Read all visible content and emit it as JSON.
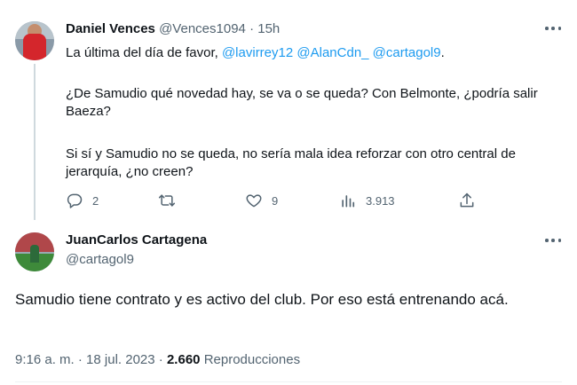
{
  "reply_tweet": {
    "author": {
      "name": "Daniel Vences",
      "handle": "@Vences1094",
      "separator": "·",
      "time": "15h"
    },
    "text": {
      "p1_prefix": "La última del día de favor, ",
      "mentions": [
        "@lavirrey12",
        "@AlanCdn_",
        "@cartagol9"
      ],
      "p1_suffix": ".",
      "p2": "¿De Samudio qué novedad hay, se va o se queda? Con Belmonte, ¿podría salir Baeza?",
      "p3": "Si sí y Samudio no se queda, no sería mala idea reforzar con otro central de jerarquía, ¿no creen?"
    },
    "actions": {
      "replies": "2",
      "retweets": "",
      "likes": "9",
      "views": "3.913"
    }
  },
  "main_tweet": {
    "author": {
      "name": "JuanCarlos Cartagena",
      "handle": "@cartagol9"
    },
    "text": "Samudio tiene contrato y es activo del club. Por eso está entrenando acá.",
    "meta": {
      "time": "9:16 a. m.",
      "separator": "·",
      "date": "18 jul. 2023",
      "views_count": "2.660",
      "views_label": "Reproducciones"
    }
  },
  "icons": {
    "reply": "reply-icon",
    "retweet": "retweet-icon",
    "like": "heart-icon",
    "views": "views-icon",
    "share": "share-icon",
    "more": "more-icon"
  },
  "colors": {
    "mention": "#1d9bf0",
    "text": "#0f1419",
    "secondary": "#536471",
    "thread_line": "#cfd9de"
  }
}
